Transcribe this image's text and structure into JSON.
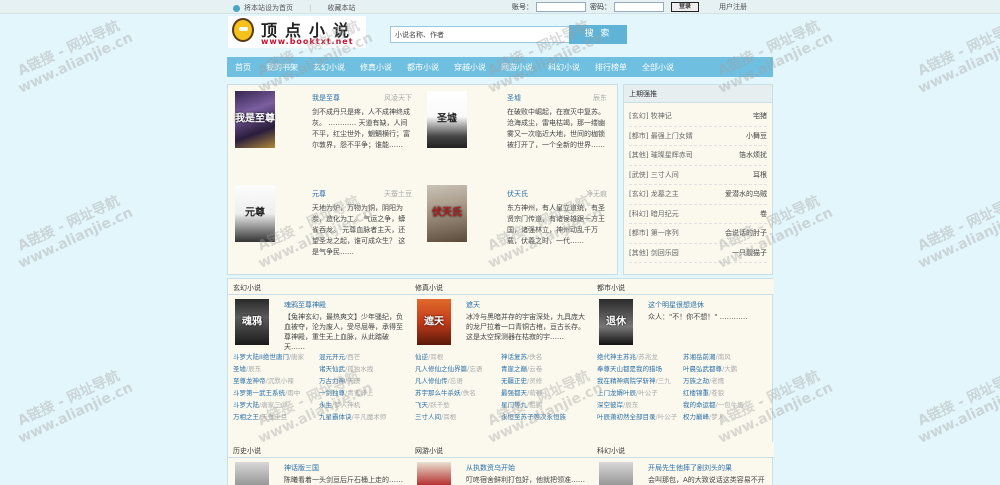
{
  "topbar": {
    "homepage_link": "将本站设为首页",
    "bookmark_link": "收藏本站",
    "account_label": "账号：",
    "password_label": "密码：",
    "login_button": "登录",
    "register_link": "用户注册"
  },
  "logo": {
    "title": "顶点小说",
    "url": "www.booktxt.net"
  },
  "search": {
    "placeholder": "小说名称、作者",
    "button": "搜 索"
  },
  "nav": [
    "首页",
    "我的书架",
    "玄幻小说",
    "修真小说",
    "都市小说",
    "穿越小说",
    "网游小说",
    "科幻小说",
    "排行榜单",
    "全部小说"
  ],
  "featured": [
    {
      "name": "我是至尊",
      "author": "风凌天下",
      "desc": "剑不成丹只是疼，人不成神终成灰。 ………… 天道有缺，人间不平，红尘世外，魍魉横行；富尔敦界，怨不平争；谁能……",
      "cover_text": "我是至尊"
    },
    {
      "name": "圣墟",
      "author": "辰东",
      "desc": "在破败中崛起，在寂灭中复苏。 沧海成尘，雷电枯竭，那一缕幽雾又一次临近大地，世间的枷锁被打开了，一个全新的世界……",
      "cover_text": "圣墟"
    },
    {
      "name": "元尊",
      "author": "天蚕土豆",
      "desc": "天地为炉，万物为铜，阴阳为炭，造化为工。 气运之争，蟒雀吞龙。 元尊血脉者主天，还望圣龙之起，谁可成众生？ 这是气争民……",
      "cover_text": "元尊"
    },
    {
      "name": "伏天氏",
      "author": "净无痕",
      "desc": "东方神州，有人皇立道统，有圣贤宗门传道，有诸侯雄踞一方王国，诸强林立，神州动乱千万载，伏羲之时，一代……",
      "cover_text": "伏天氏"
    }
  ],
  "sidebar": {
    "title": "上期强推",
    "items": [
      {
        "cat": "[玄幻]",
        "title": "牧神记",
        "author": "宅猪"
      },
      {
        "cat": "[都市]",
        "title": "最强上门女婿",
        "author": "小舞豆"
      },
      {
        "cat": "[其他]",
        "title": "璀璨星辉赤司",
        "author": "箔水烦扰"
      },
      {
        "cat": "[武侠]",
        "title": "三寸人间",
        "author": "耳根"
      },
      {
        "cat": "[玄幻]",
        "title": "龙墓之主",
        "author": "爱潜水的乌贼"
      },
      {
        "cat": "[科幻]",
        "title": "暗月纪元",
        "author": "卷"
      },
      {
        "cat": "[都市]",
        "title": "第一序列",
        "author": "会说话的肘子"
      },
      {
        "cat": "[其他]",
        "title": "剑回乐园",
        "author": "一只靓猫子"
      }
    ]
  },
  "categories": [
    {
      "title": "玄幻小说",
      "feat": {
        "name": "魂鸦至尊神殿",
        "desc": "【兔神玄幻，最热爽文】少年骚纪，负血被夺，沦为废人，受尽屈辱，承得至尊神殿，重生无上血脉，从此踏破天……",
        "cover_text": "魂鸦"
      },
      "rows": [
        [
          {
            "t": "斗罗大陆II绝世唐门",
            "a": "/唐家"
          },
          {
            "t": "混元开元",
            "a": "/西芒"
          }
        ],
        [
          {
            "t": "圣墟",
            "a": "/辰东"
          },
          {
            "t": "诸天仙武",
            "a": "/孤独水拽"
          }
        ],
        [
          {
            "t": "至尊龙神帝",
            "a": "/沉默小辣"
          },
          {
            "t": "万古力神",
            "a": "/天辰"
          }
        ],
        [
          {
            "t": "斗罗第一武王系统",
            "a": "/雨中"
          },
          {
            "t": "一剑独尊",
            "a": "/青鸾峰上"
          }
        ],
        [
          {
            "t": "斗罗大陆",
            "a": "/唐家三少"
          },
          {
            "t": "永生",
            "a": "/梦入神机"
          }
        ],
        [
          {
            "t": "万相之王",
            "a": "/天蚕土豆"
          },
          {
            "t": "九星霸体诀",
            "a": "/平凡魔术师"
          }
        ]
      ]
    },
    {
      "title": "修真小说",
      "feat": {
        "name": "遮天",
        "desc": "冰冷与黑暗并存的宇宙深处，九具庞大的龙尸拉着一口青铜古棺，亘古长存。 这是太空探测器在枯寂的宇……",
        "cover_text": "遮天"
      },
      "rows": [
        [
          {
            "t": "仙逆",
            "a": "/耳根"
          },
          {
            "t": "神话复苏",
            "a": "/佚名"
          }
        ],
        [
          {
            "t": "凡人修仙之仙界篇",
            "a": "/忘语"
          },
          {
            "t": "青崖之巅",
            "a": "/云卷"
          }
        ],
        [
          {
            "t": "凡人修仙传",
            "a": "/忘语"
          },
          {
            "t": "无疆正史",
            "a": "/灵修"
          }
        ],
        [
          {
            "t": "苏宇那么牛杀妖",
            "a": "/佚名"
          },
          {
            "t": "最强都天",
            "a": "/萌神"
          }
        ],
        [
          {
            "t": "飞天",
            "a": "/跃千愁"
          },
          {
            "t": "星门等九",
            "a": "/鲲鹏"
          }
        ],
        [
          {
            "t": "三寸人间",
            "a": "/耳根"
          },
          {
            "t": "永恒至苏子等次永恒族",
            "a": ""
          }
        ]
      ]
    },
    {
      "title": "都市小说",
      "feat": {
        "name": "这个明星很想退休",
        "desc": "众人：\"不！你不想！\" …………",
        "cover_text": "退休"
      },
      "rows": [
        [
          {
            "t": "绝代神主苏兆",
            "a": "/苏兆龙"
          },
          {
            "t": "苏湘岳前潮",
            "a": "/南风"
          }
        ],
        [
          {
            "t": "奉尊天山都是我的猎场",
            "a": ""
          },
          {
            "t": "叶晨弘武都尊",
            "a": "/大鹏"
          }
        ],
        [
          {
            "t": "我在精神病院学斩神",
            "a": "/三九"
          },
          {
            "t": "万族之劫",
            "a": "/老鹰"
          }
        ],
        [
          {
            "t": "上门龙婿叶辰",
            "a": "/叶公子"
          },
          {
            "t": "红楼锦重",
            "a": "/苍狼"
          }
        ],
        [
          {
            "t": "深空彼岸",
            "a": "/辰东"
          },
          {
            "t": "我的命运都",
            "a": "/一包牛奶"
          }
        ],
        [
          {
            "t": "叶辰萧初然全部目录",
            "a": "/叶公子"
          },
          {
            "t": "权力巅峰",
            "a": "/梦入"
          }
        ]
      ]
    },
    {
      "title": "历史小说",
      "feat": {
        "name": "神话版三国",
        "desc": "陈曦看着一头剑亘后斤石桶上走的……",
        "cover_text": ""
      }
    },
    {
      "title": "网游小说",
      "feat": {
        "name": "从执数资乌开始",
        "desc": "叮咚宿舍鲜利打包好，他就把领准……",
        "cover_text": ""
      }
    },
    {
      "title": "科幻小说",
      "feat": {
        "name": "开局先生他摔了剧刘头的果",
        "desc": "会叫那包，A的大致说话这类容易不开的……",
        "cover_text": ""
      }
    }
  ],
  "watermark": {
    "line1": "A链接 - 网址导航",
    "line2": "www.alianjie.cn"
  }
}
